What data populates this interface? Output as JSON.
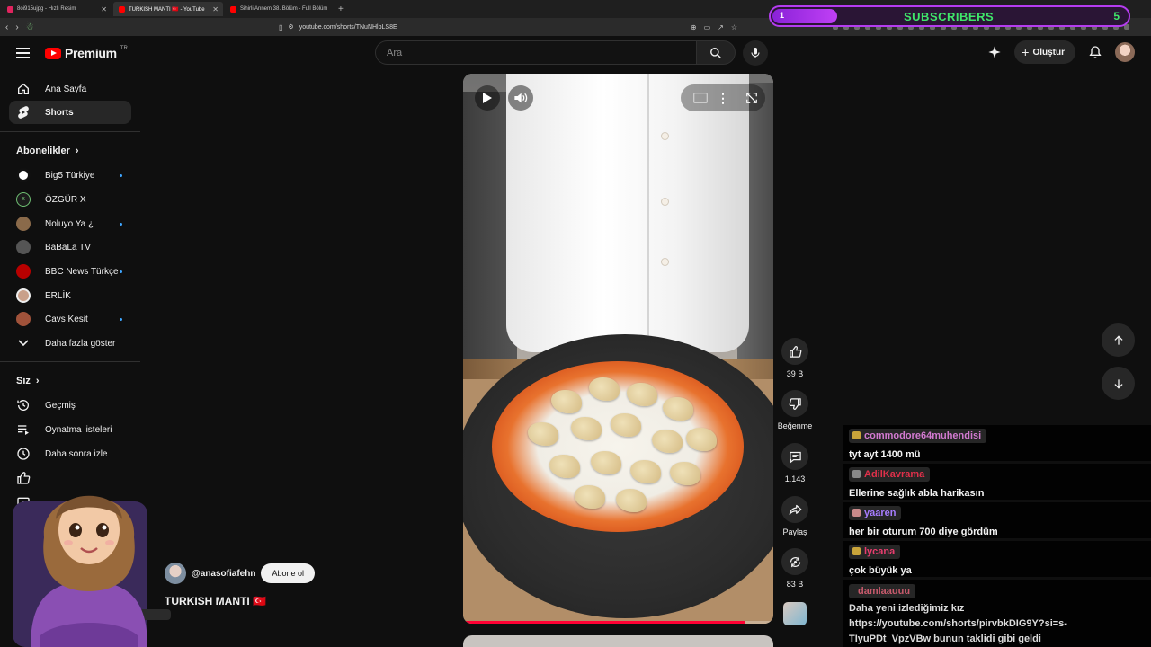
{
  "browser": {
    "tabs": [
      {
        "title": "8oi915ujpg - Hızlı Resim",
        "active": false
      },
      {
        "title": "TURKISH MANTI 🇹🇷 - YouTube",
        "active": true
      },
      {
        "title": "Sihirli Annem 38. Bölüm - Full Bölüm",
        "active": false
      }
    ],
    "url": "youtube.com/shorts/TNuNHlbLS8E"
  },
  "subscribers_goal": {
    "label": "SUBSCRIBERS",
    "start": "1",
    "end": "5",
    "progress": 0.18
  },
  "masthead": {
    "logo_word": "Premium",
    "logo_region": "TR",
    "search_placeholder": "Ara",
    "create_label": "Oluştur"
  },
  "sidebar": {
    "main": [
      {
        "label": "Ana Sayfa",
        "icon": "home-icon"
      },
      {
        "label": "Shorts",
        "icon": "shorts-icon",
        "active": true
      }
    ],
    "subscriptions_title": "Abonelikler",
    "channels": [
      {
        "label": "Big5 Türkiye",
        "avatar_text": "B5",
        "color": "#ffffff",
        "new": true
      },
      {
        "label": "ÖZGÜR X",
        "avatar_text": "X",
        "color": "#2f7d3b",
        "new": false
      },
      {
        "label": "Noluyo Ya ¿",
        "avatar_text": "N",
        "color": "#8a6a4a",
        "new": true
      },
      {
        "label": "BaBaLa TV",
        "avatar_text": "BBL",
        "color": "#555555",
        "new": false
      },
      {
        "label": "BBC News Türkçe",
        "avatar_text": "BBC",
        "color": "#b80000",
        "new": true
      },
      {
        "label": "ERLİK",
        "avatar_text": "E",
        "color": "#c9a08a",
        "new": false
      },
      {
        "label": "Cavs Kesit",
        "avatar_text": "C",
        "color": "#a0523a",
        "new": true
      }
    ],
    "show_more": "Daha fazla göster",
    "you_title": "Siz",
    "you_items": [
      {
        "label": "Geçmiş",
        "icon": "history-icon"
      },
      {
        "label": "Oynatma listeleri",
        "icon": "playlist-icon"
      },
      {
        "label": "Daha sonra izle",
        "icon": "clock-icon"
      }
    ]
  },
  "short": {
    "channel": "@anasofiafehn",
    "subscribe_label": "Abone ol",
    "title": "TURKISH MANTI 🇹🇷",
    "progress": 0.91,
    "actions": {
      "likes": "39 B",
      "dislike_label": "Beğenme",
      "comments": "1.143",
      "share_label": "Paylaş",
      "remixes": "83 B"
    }
  },
  "chat": [
    {
      "user": "commodore64muhendisi",
      "color": "#d27ad0",
      "text": "tyt ayt 1400 mü"
    },
    {
      "user": "AdilKavrama",
      "color": "#e0304a",
      "text": "Ellerine sağlık abla harikasın"
    },
    {
      "user": "yaaren",
      "color": "#a77dff",
      "text": "her bir oturum 700 diye gördüm"
    },
    {
      "user": "lycana",
      "color": "#e83d6e",
      "text": "çok büyük ya"
    },
    {
      "user": "damlaauuu",
      "color": "#c85a6c",
      "text": "Daha yeni izlediğimiz kız https://youtube.com/shorts/pirvbkDIG9Y?si=s-TIyuPDt_VpzVBw bunun taklidi gibi geldi"
    }
  ]
}
